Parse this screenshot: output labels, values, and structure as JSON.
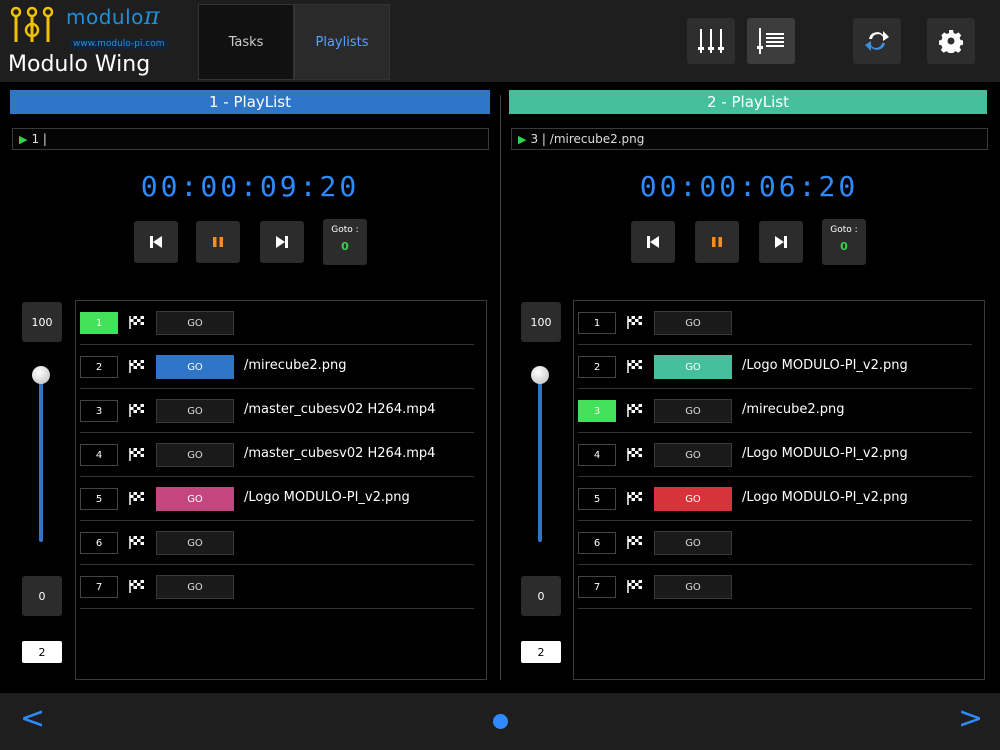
{
  "header": {
    "brand": "modulo",
    "brand_symbol": "π",
    "url": "www.modulo-pi.com",
    "app_name": "Modulo Wing",
    "tabs": [
      {
        "label": "Tasks",
        "active": false
      },
      {
        "label": "Playlists",
        "active": true
      }
    ],
    "icons": [
      "faders-icon",
      "playlist-icon",
      "sync-icon",
      "gear-icon"
    ]
  },
  "colors": {
    "accent_blue": "#2e8bff",
    "playlist1_title": "#2f76c8",
    "playlist2_title": "#44c19c",
    "active_green": "#43e05a",
    "pause_orange": "#ff8c1a"
  },
  "playlists": [
    {
      "title": "1 - PlayList",
      "now_playing": "1 |",
      "timer": "00:00:09:20",
      "goto_label": "Goto :",
      "goto_value": "0",
      "volume": {
        "max": "100",
        "min": "0",
        "value_fraction": 0.95,
        "small": "2"
      },
      "cues": [
        {
          "num": "1",
          "active": true,
          "go": "GO",
          "go_color": "",
          "file": ""
        },
        {
          "num": "2",
          "active": false,
          "go": "GO",
          "go_color": "#2f76c8",
          "file": "/mirecube2.png"
        },
        {
          "num": "3",
          "active": false,
          "go": "GO",
          "go_color": "",
          "file": "/master_cubesv02 H264.mp4"
        },
        {
          "num": "4",
          "active": false,
          "go": "GO",
          "go_color": "",
          "file": "/master_cubesv02 H264.mp4"
        },
        {
          "num": "5",
          "active": false,
          "go": "GO",
          "go_color": "#c4467f",
          "file": "/Logo MODULO-PI_v2.png"
        },
        {
          "num": "6",
          "active": false,
          "go": "GO",
          "go_color": "",
          "file": ""
        },
        {
          "num": "7",
          "active": false,
          "go": "GO",
          "go_color": "",
          "file": ""
        }
      ]
    },
    {
      "title": "2 - PlayList",
      "now_playing": "3 |  /mirecube2.png",
      "timer": "00:00:06:20",
      "goto_label": "Goto :",
      "goto_value": "0",
      "volume": {
        "max": "100",
        "min": "0",
        "value_fraction": 0.95,
        "small": "2"
      },
      "cues": [
        {
          "num": "1",
          "active": false,
          "go": "GO",
          "go_color": "",
          "file": ""
        },
        {
          "num": "2",
          "active": false,
          "go": "GO",
          "go_color": "#44c19c",
          "file": "/Logo MODULO-PI_v2.png"
        },
        {
          "num": "3",
          "active": true,
          "go": "GO",
          "go_color": "",
          "file": "/mirecube2.png"
        },
        {
          "num": "4",
          "active": false,
          "go": "GO",
          "go_color": "",
          "file": "/Logo MODULO-PI_v2.png"
        },
        {
          "num": "5",
          "active": false,
          "go": "GO",
          "go_color": "#d8323a",
          "file": "/Logo MODULO-PI_v2.png"
        },
        {
          "num": "6",
          "active": false,
          "go": "GO",
          "go_color": "",
          "file": ""
        },
        {
          "num": "7",
          "active": false,
          "go": "GO",
          "go_color": "",
          "file": ""
        }
      ]
    }
  ],
  "footer": {
    "prev": "<",
    "next": ">"
  }
}
